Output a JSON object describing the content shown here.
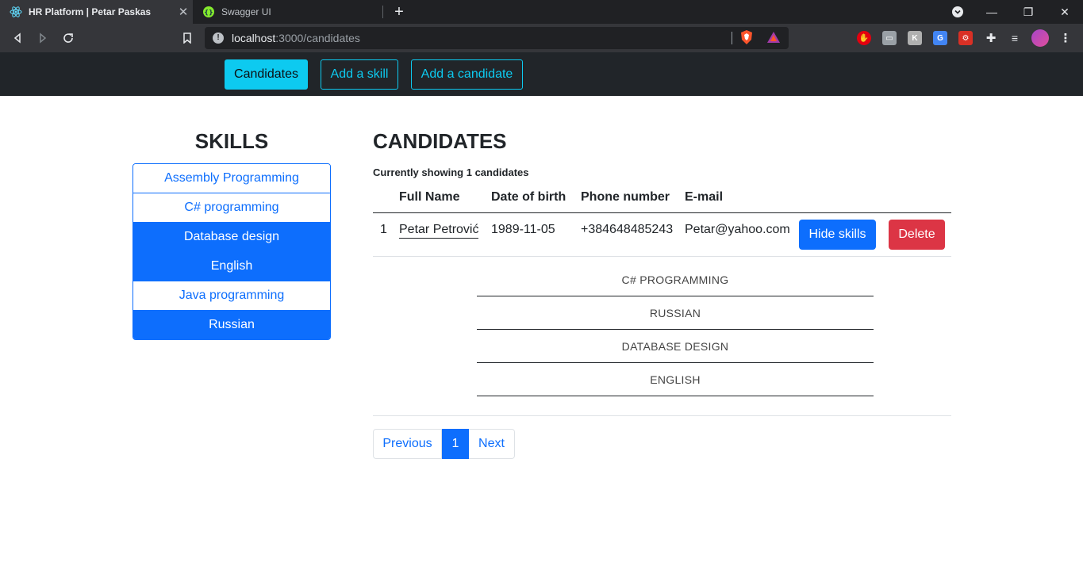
{
  "browser": {
    "tabs": [
      {
        "title": "HR Platform | Petar Paskas",
        "icon": "react-icon",
        "active": true
      },
      {
        "title": "Swagger UI",
        "icon": "swagger-icon",
        "active": false
      }
    ],
    "url_host": "localhost",
    "url_path": ":3000/candidates"
  },
  "nav": {
    "candidates": "Candidates",
    "add_skill": "Add a skill",
    "add_candidate": "Add a candidate",
    "accent": "#0dcaf0"
  },
  "skills": {
    "title": "SKILLS",
    "items": [
      {
        "label": "Assembly Programming",
        "active": false
      },
      {
        "label": "C# programming",
        "active": false
      },
      {
        "label": "Database design",
        "active": true
      },
      {
        "label": "English",
        "active": true
      },
      {
        "label": "Java programming",
        "active": false
      },
      {
        "label": "Russian",
        "active": true
      }
    ]
  },
  "candidates": {
    "title": "CANDIDATES",
    "showing": "Currently showing 1 candidates",
    "headers": [
      "Full Name",
      "Date of birth",
      "Phone number",
      "E-mail"
    ],
    "rows": [
      {
        "index": "1",
        "name": "Petar Petrović",
        "dob": "1989-11-05",
        "phone": "+384648485243",
        "email": "Petar@yahoo.com",
        "hide_skills": "Hide skills",
        "delete": "Delete"
      }
    ],
    "candidate_skills": [
      "C# PROGRAMMING",
      "RUSSIAN",
      "DATABASE DESIGN",
      "ENGLISH"
    ]
  },
  "pagination": {
    "previous": "Previous",
    "current": "1",
    "next": "Next"
  }
}
